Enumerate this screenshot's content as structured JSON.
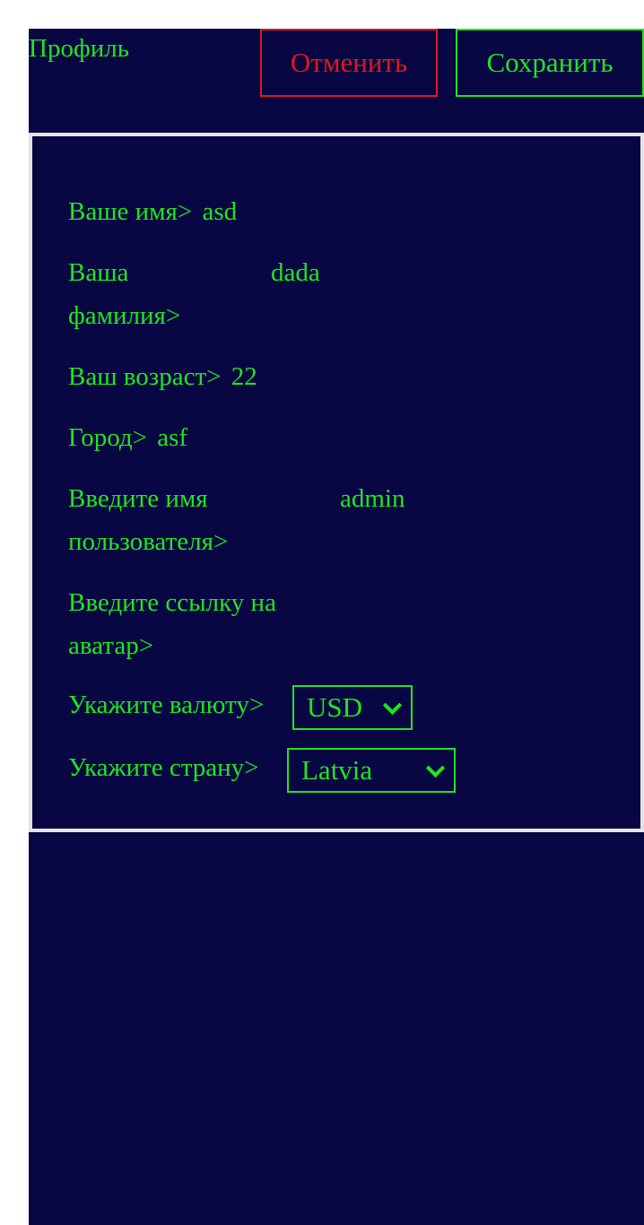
{
  "header": {
    "title": "Профиль",
    "cancel_label": "Отменить",
    "save_label": "Сохранить"
  },
  "form": {
    "first_name": {
      "label": "Ваше имя>",
      "value": "asd"
    },
    "last_name": {
      "label_line1": "Ваша",
      "label_line2": "фамилия>",
      "value": "dada"
    },
    "age": {
      "label": "Ваш возраст>",
      "value": "22"
    },
    "city": {
      "label": "Город>",
      "value": "asf"
    },
    "username": {
      "label_line1": "Введите имя",
      "label_line2": "пользователя>",
      "value": "admin"
    },
    "avatar": {
      "label_line1": "Введите ссылку на",
      "label_line2": "аватар>",
      "value": ""
    },
    "currency": {
      "label": "Укажите валюту>",
      "selected": "USD"
    },
    "country": {
      "label": "Укажите страну>",
      "selected": "Latvia"
    }
  },
  "colors": {
    "background": "#090743",
    "accent_green": "#1ee61e",
    "danger_red": "#e01818",
    "panel_border": "#e4e4e4"
  },
  "icons": {
    "select_arrow": "chevron-down-icon"
  }
}
